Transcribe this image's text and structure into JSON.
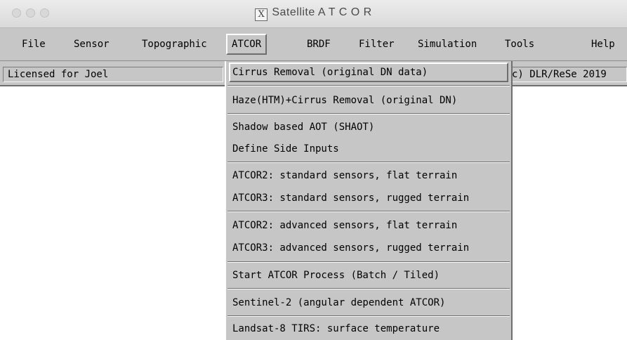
{
  "window": {
    "title": "Satellite A T C O R",
    "title_icon": "X"
  },
  "menubar": {
    "items": [
      {
        "label": "File"
      },
      {
        "label": "Sensor"
      },
      {
        "label": "Topographic"
      },
      {
        "label": "ATCOR",
        "active": true
      },
      {
        "label": "BRDF"
      },
      {
        "label": "Filter"
      },
      {
        "label": "Simulation"
      },
      {
        "label": "Tools"
      },
      {
        "label": "Help"
      }
    ]
  },
  "status": {
    "license_text": "Licensed for Joel",
    "copyright_text": "c) DLR/ReSe 2019"
  },
  "atcor_menu": {
    "items": [
      {
        "label": "Cirrus Removal (original DN data)"
      },
      {
        "label": "Haze(HTM)+Cirrus Removal (original DN)"
      },
      {
        "label": "Shadow based AOT (SHAOT)"
      },
      {
        "label": "Define Side Inputs"
      },
      {
        "label": "ATCOR2: standard sensors, flat terrain"
      },
      {
        "label": "ATCOR3: standard sensors, rugged terrain"
      },
      {
        "label": "ATCOR2: advanced sensors, flat terrain"
      },
      {
        "label": "ATCOR3: advanced sensors, rugged terrain"
      },
      {
        "label": "Start ATCOR Process (Batch / Tiled)"
      },
      {
        "label": "Sentinel-2 (angular dependent ATCOR)"
      },
      {
        "label": "Landsat-8 TIRS: surface temperature"
      }
    ]
  }
}
